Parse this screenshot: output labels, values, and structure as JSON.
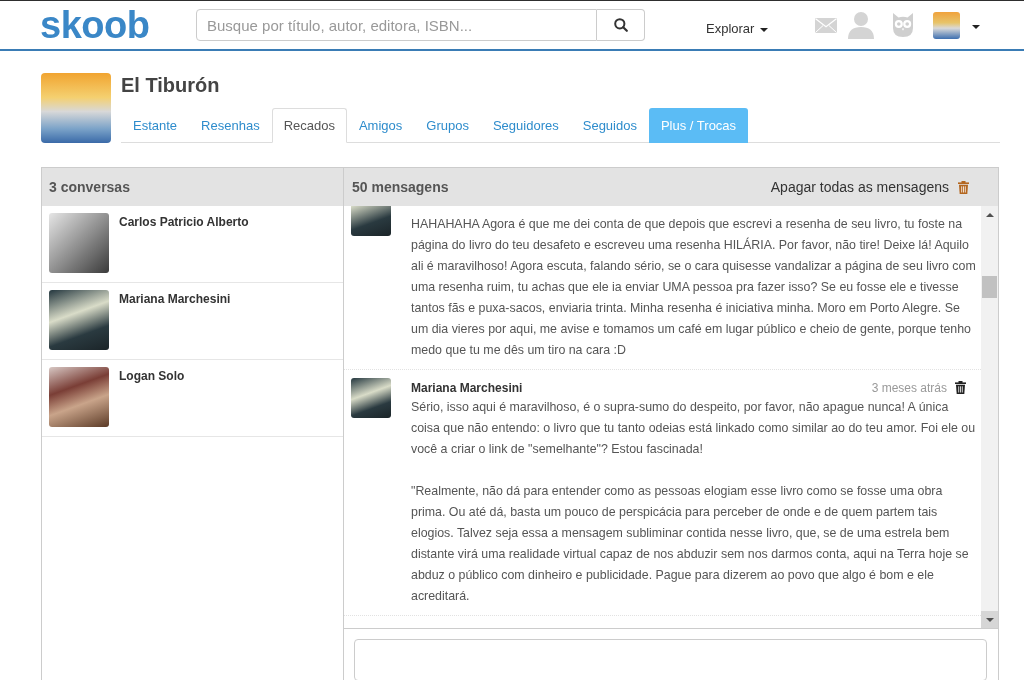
{
  "header": {
    "logo": "skoob",
    "search": {
      "placeholder": "Busque por título, autor, editora, ISBN..."
    },
    "menu": "Explorar"
  },
  "profile": {
    "name": "El Tiburón"
  },
  "tabs": [
    {
      "label": "Estante",
      "selected": false,
      "kind": "tab"
    },
    {
      "label": "Resenhas",
      "selected": false,
      "kind": "tab"
    },
    {
      "label": "Recados",
      "selected": true,
      "kind": "tab"
    },
    {
      "label": "Amigos",
      "selected": false,
      "kind": "tab"
    },
    {
      "label": "Grupos",
      "selected": false,
      "kind": "tab"
    },
    {
      "label": "Seguidores",
      "selected": false,
      "kind": "tab"
    },
    {
      "label": "Seguidos",
      "selected": false,
      "kind": "tab"
    },
    {
      "label": "Plus / Trocas",
      "selected": false,
      "kind": "highlight"
    }
  ],
  "conversations": {
    "title": "3 conversas",
    "items": [
      {
        "name": "Carlos Patricio Alberto",
        "selected": false
      },
      {
        "name": "Mariana Marchesini",
        "selected": false
      },
      {
        "name": "Logan Solo",
        "selected": false
      }
    ]
  },
  "messages": {
    "title": "50 mensagens",
    "delete_all": "Apagar todas as mensagens",
    "items": [
      {
        "paragraphs": [
          "HAHAHAHA Agora é que me dei conta de que depois que escrevi a resenha de seu livro, tu foste na página do livro do teu desafeto e escreveu uma resenha HILÁRIA. Por favor, não tire! Deixe lá! Aquilo ali é maravilhoso! Agora escuta, falando sério, se o cara quisesse vandalizar a página de seu livro com uma resenha ruim, tu achas que ele ia enviar UMA pessoa pra fazer isso? Se eu fosse ele e tivesse tantos fãs e puxa-sacos, enviaria trinta. Minha resenha é iniciativa minha. Moro em Porto Alegre. Se um dia vieres por aqui, me avise e tomamos um café em lugar público e cheio de gente, porque tenho medo que tu me dês um tiro na cara :D"
        ]
      },
      {
        "author": "Mariana Marchesini",
        "time": "3 meses atrás",
        "paragraphs": [
          "Sério, isso aqui é maravilhoso, é o supra-sumo do despeito, por favor, não apague nunca! A única coisa que não entendo: o livro que tu tanto odeias está linkado como similar ao do teu amor. Foi ele ou você a criar o link de \"semelhante\"? Estou fascinada!",
          "\"Realmente, não dá para entender como as pessoas elogiam esse livro como se fosse uma obra prima. Ou até dá, basta um pouco de perspicácia para perceber de onde e de quem partem tais elogios. Talvez seja essa a mensagem subliminar contida nesse livro, que, se de uma estrela bem distante virá uma realidade virtual capaz de nos abduzir sem nos darmos conta, aqui na Terra hoje se abduz o público com dinheiro e publicidade. Pague para dizerem ao povo que algo é bom e ele acreditará."
        ]
      }
    ]
  }
}
